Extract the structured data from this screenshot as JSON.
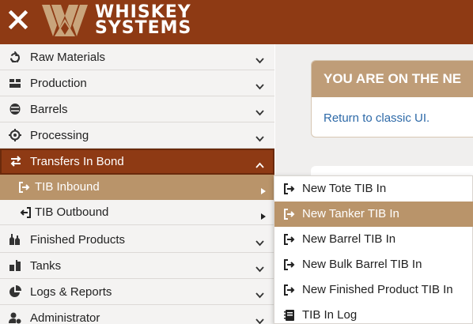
{
  "header": {
    "logo_line1": "WHISKEY",
    "logo_line2": "SYSTEMS",
    "close_icon": "close-icon",
    "background": "#8e3a14"
  },
  "sidebar": {
    "items": [
      {
        "label": "Raw Materials",
        "icon": "recycle-icon",
        "expanded": false
      },
      {
        "label": "Production",
        "icon": "production-icon",
        "expanded": false
      },
      {
        "label": "Barrels",
        "icon": "barrel-icon",
        "expanded": false
      },
      {
        "label": "Processing",
        "icon": "processing-icon",
        "expanded": false
      },
      {
        "label": "Transfers In Bond",
        "icon": "transfer-icon",
        "expanded": true,
        "active": true
      },
      {
        "label": "Finished Products",
        "icon": "bottles-icon",
        "expanded": false
      },
      {
        "label": "Tanks",
        "icon": "tanks-icon",
        "expanded": false
      },
      {
        "label": "Logs & Reports",
        "icon": "pie-chart-icon",
        "expanded": false
      },
      {
        "label": "Administrator",
        "icon": "user-cog-icon",
        "expanded": false
      }
    ],
    "subitems": [
      {
        "label": "TIB Inbound",
        "icon": "sign-in-icon",
        "highlighted": true
      },
      {
        "label": "TIB Outbound",
        "icon": "sign-out-icon",
        "highlighted": false
      }
    ]
  },
  "main": {
    "notice_title": "YOU ARE ON THE NE",
    "notice_link": "Return to classic UI."
  },
  "dropdown": {
    "items": [
      {
        "label": "New Tote TIB In",
        "icon": "sign-in-icon",
        "highlighted": false
      },
      {
        "label": "New Tanker TIB In",
        "icon": "sign-in-icon",
        "highlighted": true
      },
      {
        "label": "New Barrel TIB In",
        "icon": "sign-in-icon",
        "highlighted": false
      },
      {
        "label": "New Bulk Barrel TIB In",
        "icon": "sign-in-icon",
        "highlighted": false
      },
      {
        "label": "New Finished Product TIB In",
        "icon": "sign-in-icon",
        "highlighted": false
      },
      {
        "label": "TIB In Log",
        "icon": "log-book-icon",
        "highlighted": false
      }
    ]
  },
  "colors": {
    "brand": "#8e3a14",
    "accent": "#b9946a",
    "link": "#2e6aa8"
  }
}
